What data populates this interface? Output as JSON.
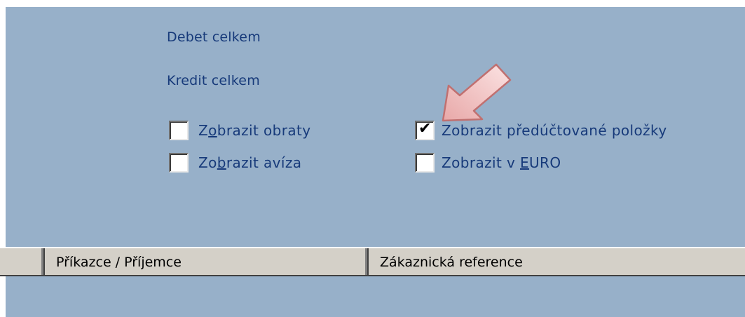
{
  "summary": {
    "debit_total_label": "Debet celkem",
    "credit_total_label": "Kredit celkem"
  },
  "options": {
    "show_turnover": {
      "prefix": "Z",
      "accel": "o",
      "rest": "brazit obraty",
      "checked": false
    },
    "show_advices": {
      "prefix": "Zo",
      "accel": "b",
      "rest": "razit avíza",
      "checked": false
    },
    "show_prebooked": {
      "label": "Zobrazit předúčtované položky",
      "checked": true
    },
    "show_euro": {
      "prefix": "Zobrazit v ",
      "accel": "E",
      "rest": "URO",
      "checked": false
    }
  },
  "table": {
    "columns": [
      "",
      "Příkazce / Příjemce",
      "Zákaznická reference"
    ]
  },
  "colors": {
    "panel_bg": "#97b0c9",
    "label_text": "#173a7a",
    "header_bg": "#d4d0c8",
    "arrow_fill": "#f2c7c7",
    "arrow_stroke": "#c07070"
  },
  "icons": {
    "checkmark": "check-icon",
    "pointer_arrow": "arrow-icon"
  }
}
